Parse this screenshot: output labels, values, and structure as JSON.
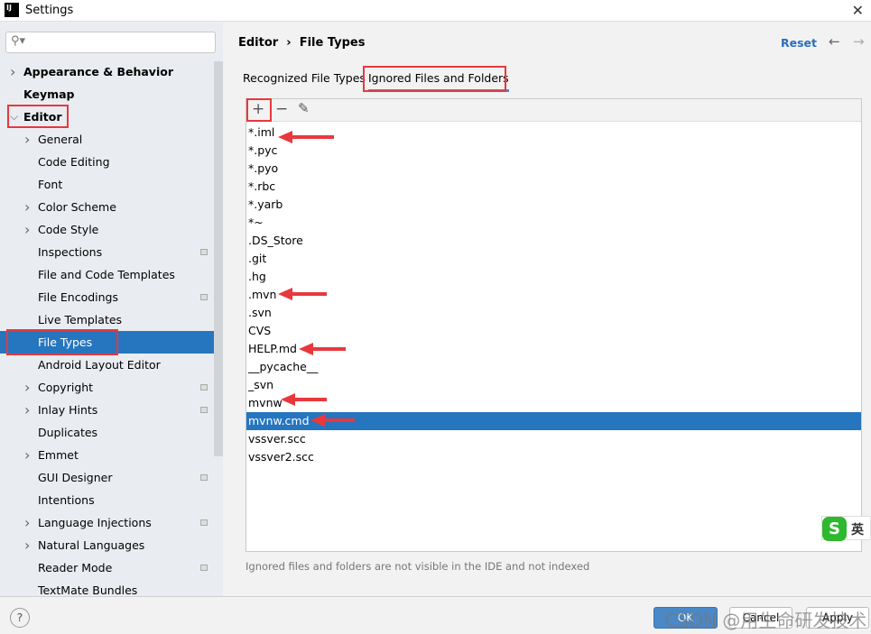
{
  "window": {
    "title": "Settings",
    "app_icon": "IJ"
  },
  "search": {
    "placeholder": "",
    "icon": "search-icon"
  },
  "sidebar": {
    "items": [
      {
        "label": "Appearance & Behavior",
        "level": 0,
        "bold": true,
        "chevron": "right"
      },
      {
        "label": "Keymap",
        "level": 0,
        "bold": true
      },
      {
        "label": "Editor",
        "level": 0,
        "bold": true,
        "chevron": "down"
      },
      {
        "label": "General",
        "level": 1,
        "chevron": "right"
      },
      {
        "label": "Code Editing",
        "level": 1
      },
      {
        "label": "Font",
        "level": 1
      },
      {
        "label": "Color Scheme",
        "level": 1,
        "chevron": "right"
      },
      {
        "label": "Code Style",
        "level": 1,
        "chevron": "right"
      },
      {
        "label": "Inspections",
        "level": 1,
        "badge": true
      },
      {
        "label": "File and Code Templates",
        "level": 1
      },
      {
        "label": "File Encodings",
        "level": 1,
        "badge": true
      },
      {
        "label": "Live Templates",
        "level": 1
      },
      {
        "label": "File Types",
        "level": 1,
        "selected": true
      },
      {
        "label": "Android Layout Editor",
        "level": 1
      },
      {
        "label": "Copyright",
        "level": 1,
        "chevron": "right",
        "badge": true
      },
      {
        "label": "Inlay Hints",
        "level": 1,
        "chevron": "right",
        "badge": true
      },
      {
        "label": "Duplicates",
        "level": 1
      },
      {
        "label": "Emmet",
        "level": 1,
        "chevron": "right"
      },
      {
        "label": "GUI Designer",
        "level": 1,
        "badge": true
      },
      {
        "label": "Intentions",
        "level": 1
      },
      {
        "label": "Language Injections",
        "level": 1,
        "chevron": "right",
        "badge": true
      },
      {
        "label": "Natural Languages",
        "level": 1,
        "chevron": "right"
      },
      {
        "label": "Reader Mode",
        "level": 1,
        "badge": true
      },
      {
        "label": "TextMate Bundles",
        "level": 1
      }
    ]
  },
  "header": {
    "breadcrumb_parent": "Editor",
    "breadcrumb_sep": "›",
    "breadcrumb_current": "File Types",
    "reset": "Reset"
  },
  "tabs": [
    {
      "label": "Recognized File Types"
    },
    {
      "label": "Ignored Files and Folders",
      "active": true
    }
  ],
  "toolbar": {
    "add": "+",
    "remove": "−",
    "edit": "✎"
  },
  "ignored": [
    "*.iml",
    "*.pyc",
    "*.pyo",
    "*.rbc",
    "*.yarb",
    "*~",
    ".DS_Store",
    ".git",
    ".hg",
    ".mvn",
    ".svn",
    "CVS",
    "HELP.md",
    "__pycache__",
    "_svn",
    "mvnw",
    "mvnw.cmd",
    "vssver.scc",
    "vssver2.scc"
  ],
  "selected_entry": "mvnw.cmd",
  "hint": "Ignored files and folders are not visible in the IDE and not indexed",
  "buttons": {
    "ok": "OK",
    "cancel": "Cancel",
    "apply": "Apply",
    "help": "?"
  },
  "watermark": "CSDN @用生命研发技术",
  "ime": {
    "logo": "S",
    "mode": "英"
  },
  "colors": {
    "selection": "#2675bf",
    "annotation": "#e8383d",
    "link": "#2a6ebb"
  }
}
